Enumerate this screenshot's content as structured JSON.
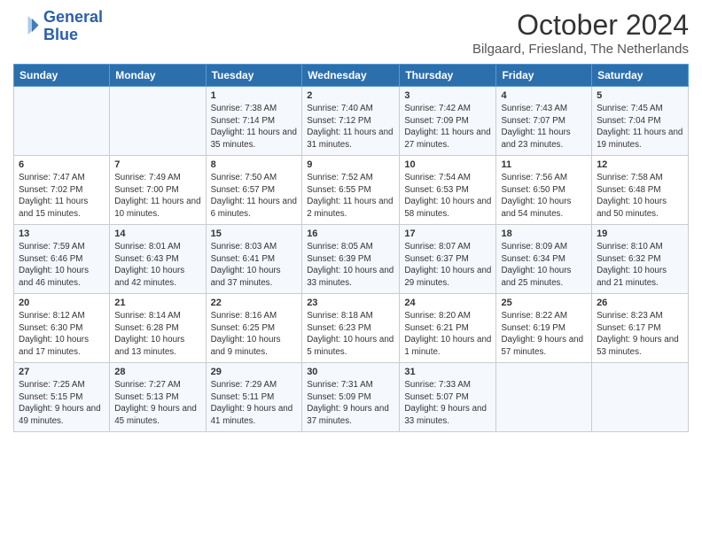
{
  "header": {
    "logo_line1": "General",
    "logo_line2": "Blue",
    "main_title": "October 2024",
    "subtitle": "Bilgaard, Friesland, The Netherlands"
  },
  "days_of_week": [
    "Sunday",
    "Monday",
    "Tuesday",
    "Wednesday",
    "Thursday",
    "Friday",
    "Saturday"
  ],
  "weeks": [
    [
      {
        "day": "",
        "content": ""
      },
      {
        "day": "",
        "content": ""
      },
      {
        "day": "1",
        "content": "Sunrise: 7:38 AM\nSunset: 7:14 PM\nDaylight: 11 hours and 35 minutes."
      },
      {
        "day": "2",
        "content": "Sunrise: 7:40 AM\nSunset: 7:12 PM\nDaylight: 11 hours and 31 minutes."
      },
      {
        "day": "3",
        "content": "Sunrise: 7:42 AM\nSunset: 7:09 PM\nDaylight: 11 hours and 27 minutes."
      },
      {
        "day": "4",
        "content": "Sunrise: 7:43 AM\nSunset: 7:07 PM\nDaylight: 11 hours and 23 minutes."
      },
      {
        "day": "5",
        "content": "Sunrise: 7:45 AM\nSunset: 7:04 PM\nDaylight: 11 hours and 19 minutes."
      }
    ],
    [
      {
        "day": "6",
        "content": "Sunrise: 7:47 AM\nSunset: 7:02 PM\nDaylight: 11 hours and 15 minutes."
      },
      {
        "day": "7",
        "content": "Sunrise: 7:49 AM\nSunset: 7:00 PM\nDaylight: 11 hours and 10 minutes."
      },
      {
        "day": "8",
        "content": "Sunrise: 7:50 AM\nSunset: 6:57 PM\nDaylight: 11 hours and 6 minutes."
      },
      {
        "day": "9",
        "content": "Sunrise: 7:52 AM\nSunset: 6:55 PM\nDaylight: 11 hours and 2 minutes."
      },
      {
        "day": "10",
        "content": "Sunrise: 7:54 AM\nSunset: 6:53 PM\nDaylight: 10 hours and 58 minutes."
      },
      {
        "day": "11",
        "content": "Sunrise: 7:56 AM\nSunset: 6:50 PM\nDaylight: 10 hours and 54 minutes."
      },
      {
        "day": "12",
        "content": "Sunrise: 7:58 AM\nSunset: 6:48 PM\nDaylight: 10 hours and 50 minutes."
      }
    ],
    [
      {
        "day": "13",
        "content": "Sunrise: 7:59 AM\nSunset: 6:46 PM\nDaylight: 10 hours and 46 minutes."
      },
      {
        "day": "14",
        "content": "Sunrise: 8:01 AM\nSunset: 6:43 PM\nDaylight: 10 hours and 42 minutes."
      },
      {
        "day": "15",
        "content": "Sunrise: 8:03 AM\nSunset: 6:41 PM\nDaylight: 10 hours and 37 minutes."
      },
      {
        "day": "16",
        "content": "Sunrise: 8:05 AM\nSunset: 6:39 PM\nDaylight: 10 hours and 33 minutes."
      },
      {
        "day": "17",
        "content": "Sunrise: 8:07 AM\nSunset: 6:37 PM\nDaylight: 10 hours and 29 minutes."
      },
      {
        "day": "18",
        "content": "Sunrise: 8:09 AM\nSunset: 6:34 PM\nDaylight: 10 hours and 25 minutes."
      },
      {
        "day": "19",
        "content": "Sunrise: 8:10 AM\nSunset: 6:32 PM\nDaylight: 10 hours and 21 minutes."
      }
    ],
    [
      {
        "day": "20",
        "content": "Sunrise: 8:12 AM\nSunset: 6:30 PM\nDaylight: 10 hours and 17 minutes."
      },
      {
        "day": "21",
        "content": "Sunrise: 8:14 AM\nSunset: 6:28 PM\nDaylight: 10 hours and 13 minutes."
      },
      {
        "day": "22",
        "content": "Sunrise: 8:16 AM\nSunset: 6:25 PM\nDaylight: 10 hours and 9 minutes."
      },
      {
        "day": "23",
        "content": "Sunrise: 8:18 AM\nSunset: 6:23 PM\nDaylight: 10 hours and 5 minutes."
      },
      {
        "day": "24",
        "content": "Sunrise: 8:20 AM\nSunset: 6:21 PM\nDaylight: 10 hours and 1 minute."
      },
      {
        "day": "25",
        "content": "Sunrise: 8:22 AM\nSunset: 6:19 PM\nDaylight: 9 hours and 57 minutes."
      },
      {
        "day": "26",
        "content": "Sunrise: 8:23 AM\nSunset: 6:17 PM\nDaylight: 9 hours and 53 minutes."
      }
    ],
    [
      {
        "day": "27",
        "content": "Sunrise: 7:25 AM\nSunset: 5:15 PM\nDaylight: 9 hours and 49 minutes."
      },
      {
        "day": "28",
        "content": "Sunrise: 7:27 AM\nSunset: 5:13 PM\nDaylight: 9 hours and 45 minutes."
      },
      {
        "day": "29",
        "content": "Sunrise: 7:29 AM\nSunset: 5:11 PM\nDaylight: 9 hours and 41 minutes."
      },
      {
        "day": "30",
        "content": "Sunrise: 7:31 AM\nSunset: 5:09 PM\nDaylight: 9 hours and 37 minutes."
      },
      {
        "day": "31",
        "content": "Sunrise: 7:33 AM\nSunset: 5:07 PM\nDaylight: 9 hours and 33 minutes."
      },
      {
        "day": "",
        "content": ""
      },
      {
        "day": "",
        "content": ""
      }
    ]
  ]
}
